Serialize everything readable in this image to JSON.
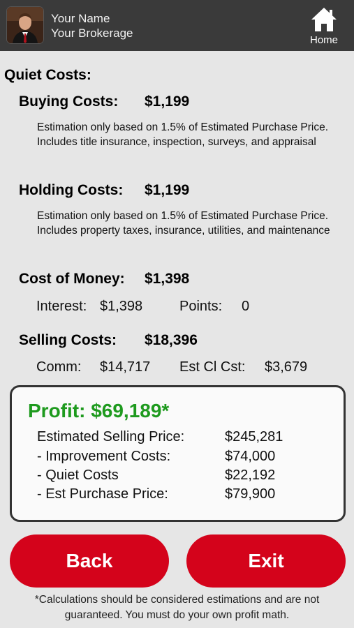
{
  "header": {
    "name": "Your Name",
    "brokerage": "Your Brokerage",
    "home_label": "Home"
  },
  "quiet_costs": {
    "title": "Quiet Costs:",
    "buying": {
      "label": "Buying Costs:",
      "value": "$1,199",
      "note": "Estimation only based on 1.5% of Estimated Purchase Price. Includes title insurance, inspection, surveys, and appraisal"
    },
    "holding": {
      "label": "Holding Costs:",
      "value": "$1,199",
      "note": "Estimation only based on 1.5% of Estimated Purchase Price. Includes property taxes, insurance, utilities, and maintenance"
    },
    "money": {
      "label": "Cost of Money:",
      "value": "$1,398",
      "interest_label": "Interest:",
      "interest_value": "$1,398",
      "points_label": "Points:",
      "points_value": "0"
    },
    "selling": {
      "label": "Selling Costs:",
      "value": "$18,396",
      "comm_label": "Comm:",
      "comm_value": "$14,717",
      "closing_label": "Est Cl Cst:",
      "closing_value": "$3,679"
    }
  },
  "profit": {
    "label": "Profit:  $69,189*",
    "rows": [
      {
        "label": "Estimated Selling Price:",
        "value": "$245,281"
      },
      {
        "label": "- Improvement Costs:",
        "value": "$74,000"
      },
      {
        "label": "- Quiet Costs",
        "value": "$22,192"
      },
      {
        "label": "- Est Purchase Price:",
        "value": "$79,900"
      }
    ],
    "color": "#1e9a1e"
  },
  "buttons": {
    "back": "Back",
    "exit": "Exit",
    "color": "#d4031b"
  },
  "disclaimer": "*Calculations should be considered estimations and are not guaranteed. You must do your own profit math."
}
